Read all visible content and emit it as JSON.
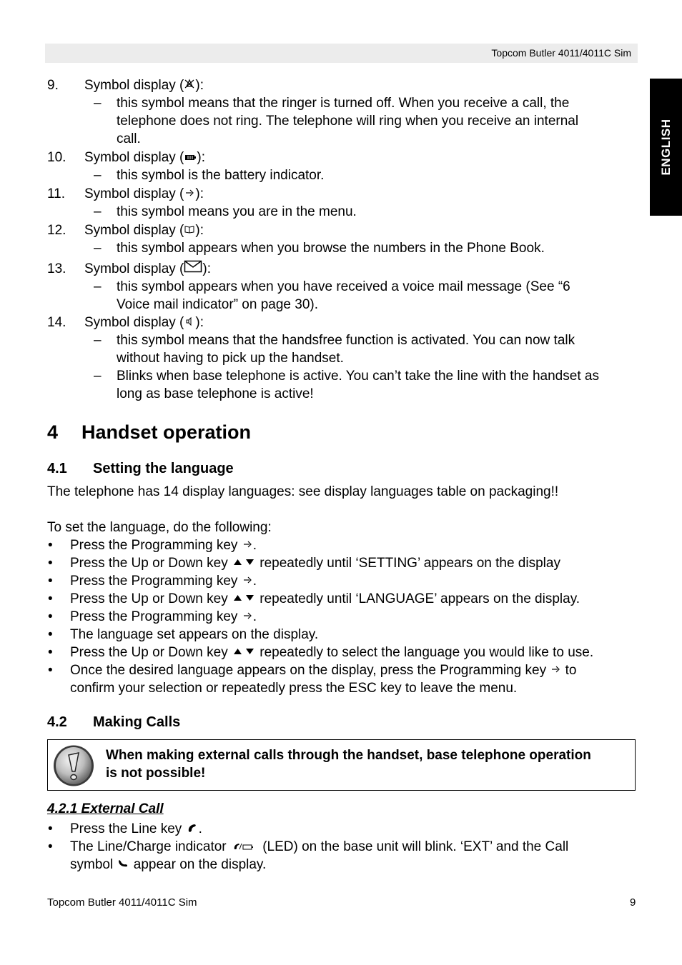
{
  "header": {
    "title": "Topcom Butler 4011/4011C Sim"
  },
  "side_tab": {
    "label": "ENGLISH"
  },
  "symbol_list": [
    {
      "number": "9.",
      "label_before": "Symbol display (",
      "icon": "ringer-off-icon",
      "label_after": "):",
      "lines": [
        "this symbol means that the ringer is turned off. When you receive a call, the",
        "telephone does not ring. The telephone will ring when you receive an internal",
        "call."
      ]
    },
    {
      "number": "10.",
      "label_before": "Symbol display (",
      "icon": "battery-icon",
      "label_after": "):",
      "lines": [
        "this symbol is the battery indicator."
      ]
    },
    {
      "number": "11.",
      "label_before": "Symbol display (",
      "icon": "menu-icon",
      "label_after": "):",
      "lines": [
        "this symbol means you are in the menu."
      ]
    },
    {
      "number": "12.",
      "label_before": "Symbol display (",
      "icon": "phonebook-icon",
      "label_after": "):",
      "lines": [
        "this symbol appears when you browse the numbers in the Phone Book."
      ]
    },
    {
      "number": "13.",
      "label_before": "Symbol display (",
      "icon": "envelope-icon",
      "label_after": "):",
      "lines": [
        "this symbol appears when you have received a voice mail message (See “6",
        "Voice mail indicator” on page 30)."
      ]
    },
    {
      "number": "14.",
      "label_before": "Symbol display (",
      "icon": "speaker-icon",
      "label_after": "):",
      "lines": [
        "this symbol means that the handsfree function is activated. You can now talk",
        "without having to pick up the handset."
      ],
      "lines2": [
        "Blinks when base telephone is active. You can’t take the line with the handset as",
        "long as base telephone is active!"
      ]
    }
  ],
  "section4": {
    "number": "4",
    "title": "Handset operation",
    "sub1": {
      "number": "4.1",
      "title": "Setting the language",
      "intro": "The telephone has 14 display languages: see display languages table on packaging!!",
      "lead": "To set the language, do the following:",
      "bullets": [
        {
          "before": "Press the Programming key ",
          "icon": "programming-key-icon",
          "after": "."
        },
        {
          "before": "Press the Up or Down key ",
          "icon": "up-down-keys-icon",
          "after": " repeatedly until ‘SETTING’ appears on the display"
        },
        {
          "before": "Press the Programming key ",
          "icon": "programming-key-icon",
          "after": "."
        },
        {
          "before": "Press the Up or Down key ",
          "icon": "up-down-keys-icon",
          "after": " repeatedly until ‘LANGUAGE’ appears on the display."
        },
        {
          "before": "Press the Programming key ",
          "icon": "programming-key-icon",
          "after": "."
        },
        {
          "before": "The language set appears on the display.",
          "icon": "",
          "after": ""
        },
        {
          "before": "Press the Up or Down key ",
          "icon": "up-down-keys-icon",
          "after": " repeatedly to select the language you would like to use."
        },
        {
          "before": "Once the desired language appears on the display, press the Programming key ",
          "icon": "programming-key-icon",
          "after": " to",
          "cont": "confirm your selection or repeatedly press the ESC key to leave the menu."
        }
      ]
    },
    "sub2": {
      "number": "4.2",
      "title": "Making Calls",
      "warning": [
        "When making external calls through the handset, base telephone operation",
        "is not possible!"
      ],
      "sub21": {
        "title": "4.2.1 External Call",
        "bullets": [
          {
            "before": "Press the Line key ",
            "icon": "line-key-icon",
            "after": "."
          },
          {
            "before": "The Line/Charge indicator ",
            "icon": "line-charge-indicator-icon",
            "after": " (LED) on the base unit will blink. ‘EXT’ and the Call",
            "cont_before": "symbol ",
            "cont_icon": "call-symbol-icon",
            "cont_after": " appear on the display."
          }
        ]
      }
    }
  },
  "footer": {
    "left": "Topcom Butler 4011/4011C Sim",
    "page_number": "9"
  }
}
